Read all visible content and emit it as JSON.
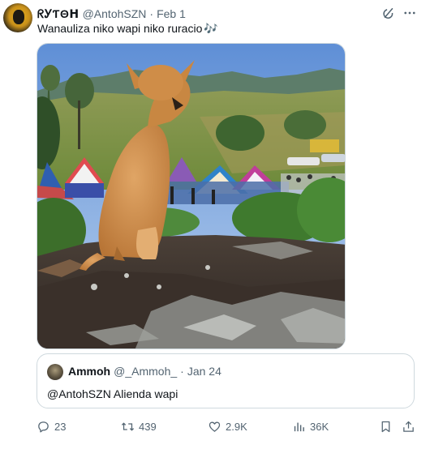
{
  "tweet": {
    "display_name": "ᖇᎩƬΘᕼ",
    "handle": "@AntohSZN",
    "separator": "·",
    "date": "Feb 1",
    "text": "Wanauliza niko wapi niko ruracio",
    "emoji": "🎶"
  },
  "quote": {
    "display_name": "Ammoh",
    "handle": "@_Ammoh_",
    "separator": "·",
    "date": "Jan 24",
    "text": "@AntohSZN Alienda wapi"
  },
  "actions": {
    "replies": "23",
    "reposts": "439",
    "likes": "2.9K",
    "views": "36K"
  },
  "icons": {
    "grok": "grok-icon",
    "more": "more-icon",
    "reply": "reply-icon",
    "repost": "repost-icon",
    "like": "heart-icon",
    "views": "views-icon",
    "bookmark": "bookmark-icon",
    "share": "share-icon"
  },
  "colors": {
    "text": "#0f1419",
    "secondary": "#536471",
    "accent": "#1d9bf0",
    "border": "#cfd9de"
  }
}
